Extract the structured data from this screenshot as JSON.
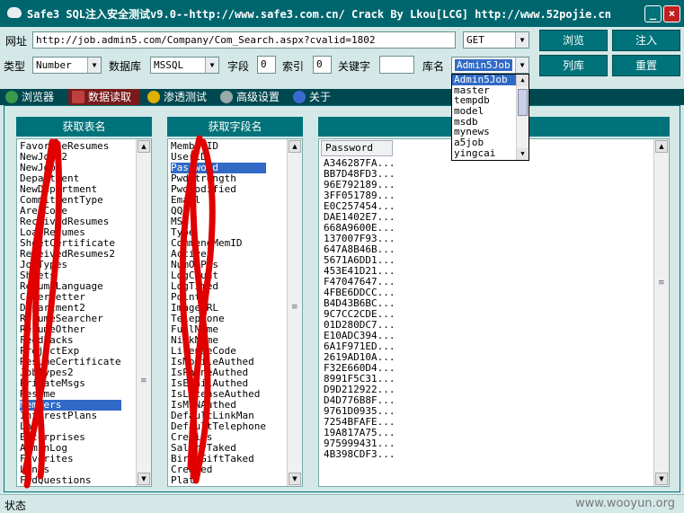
{
  "title": "Safe3 SQL注入安全测试v9.0--http://www.safe3.com.cn/   Crack By Lkou[LCG]  http://www.52pojie.cn",
  "window_buttons": {
    "minimize": "_",
    "close": "×"
  },
  "form": {
    "url_label": "网址",
    "url_value": "http://job.admin5.com/Company/Com_Search.aspx?cvalid=1802",
    "method_value": "GET",
    "type_label": "类型",
    "type_value": "Number",
    "db_label": "数据库",
    "db_value": "MSSQL",
    "field_label": "字段",
    "field_value": "0",
    "index_label": "索引",
    "index_value": "0",
    "keyword_label": "关键字",
    "keyword_value": "",
    "dbname_label": "库名",
    "dbname_value": "Admin5Job"
  },
  "buttons": {
    "browse": "浏览",
    "inject": "注入",
    "list_db": "列库",
    "reset": "重置"
  },
  "db_options": [
    "Admin5Job",
    "master",
    "tempdb",
    "model",
    "msdb",
    "mynews",
    "a5job",
    "yingcai"
  ],
  "tabs": [
    {
      "label": "浏览器"
    },
    {
      "label": "数据读取"
    },
    {
      "label": "渗透测试"
    },
    {
      "label": "高级设置"
    },
    {
      "label": "关于"
    }
  ],
  "panels": {
    "tables_header": "获取表名",
    "fields_header": "获取字段名",
    "data_column": "Password"
  },
  "tables": [
    "FavoriteResumes",
    "NewJobs2",
    "NewJobs",
    "Department",
    "NewDepartment",
    "CommitmentType",
    "AreaCode",
    "ReceivedResumes",
    "LoadResumes",
    "SheetCertificate",
    "ReceivedResumes2",
    "JobTypes",
    "Sheets",
    "ResumeLanguage",
    "CoverLetter",
    "Department2",
    "ResumeSearcher",
    "ResumeOther",
    "FeedBacks",
    "ProjectExp",
    "ResumeCertificate",
    "JobTypes2",
    "PrivateMsgs",
    "Resume",
    "Members",
    "InterestPlans",
    "Log",
    "Enterprises",
    "AdminLog",
    "Favorites",
    "Links",
    "FwdQuestions"
  ],
  "selected_table": "Members",
  "fields": [
    "MemberID",
    "UserID",
    "Password",
    "PwdStrength",
    "PwdModified",
    "Email",
    "QQ",
    "MSN",
    "Type",
    "CommendMemID",
    "Active",
    "NumOfPos",
    "LogCount",
    "LogTimed",
    "Points",
    "ImageURL",
    "Telephone",
    "FullName",
    "NickName",
    "LicenseCode",
    "IsMobileAuthed",
    "IsPhoneAuthed",
    "IsEmailAuthed",
    "IsLicenseAuthed",
    "IsMSNAuthed",
    "DefaultLinkMan",
    "DefaultTelephone",
    "Credits",
    "SalaryTaked",
    "BirthGiftTaked",
    "Created",
    "Plat"
  ],
  "selected_field": "Password",
  "passwords": [
    "A346287FA...",
    "BB7D48FD3...",
    "96E792189...",
    "3FF051789...",
    "E0C257454...",
    "DAE1402E7...",
    "668A9600E...",
    "137007F93...",
    "647A8B46B...",
    "5671A6DD1...",
    "453E41D21...",
    "F47047647...",
    "4FBE6DDCC...",
    "B4D43B6BC...",
    "9C7CC2CDE...",
    "01D280DC7...",
    "E10ADC394...",
    "6A1F971ED...",
    "2619AD10A...",
    "F32E660D4...",
    "8991F5C31...",
    "D9D212922...",
    "D4D776B8F...",
    "9761D0935...",
    "7254BFAFE...",
    "19A817A75...",
    "975999431...",
    "4B398CDF3..."
  ],
  "status_label": "状态",
  "watermark": "www.wooyun.org",
  "colors": {
    "accent": "#00727a",
    "titlebar": "#00666e",
    "selection": "#316ac5",
    "close": "#c0201f"
  }
}
